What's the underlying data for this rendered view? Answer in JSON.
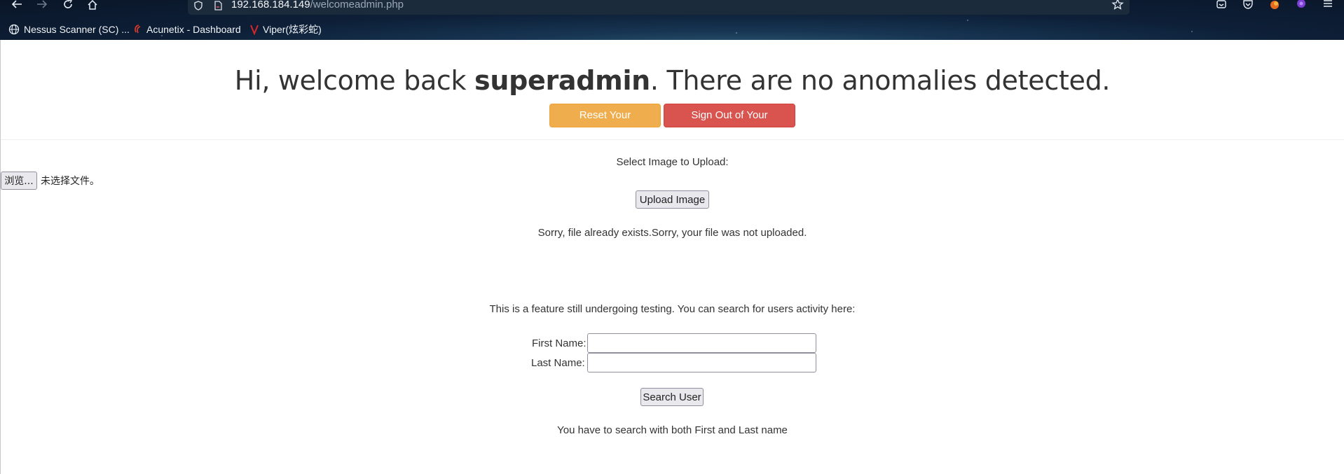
{
  "browser": {
    "url_host": "192.168.184.149",
    "url_path": "/welcomeadmin.php",
    "bookmarks": [
      {
        "label": "Nessus Scanner (SC) ...",
        "icon": "globe-icon"
      },
      {
        "label": "Acunetix - Dashboard",
        "icon": "acunetix-logo-icon"
      },
      {
        "label": "Viper(炫彩蛇)",
        "icon": "viper-logo-icon"
      }
    ]
  },
  "header": {
    "greeting_prefix": "Hi, welcome back",
    "username": "superadmin",
    "greeting_suffix": ". There are no anomalies detected."
  },
  "actions": {
    "reset_password_label": "Reset Your Password",
    "sign_out_label": "Sign Out of Your Account"
  },
  "upload": {
    "prompt": "Select Image to Upload:",
    "browse_label": "浏览...",
    "file_status": "未选择文件。",
    "upload_button_label": "Upload Image",
    "result_message": "Sorry, file already exists.Sorry, your file was not uploaded."
  },
  "search": {
    "intro": "This is a feature still undergoing testing. You can search for users activity here:",
    "first_name_label": "First Name:",
    "first_name_value": "",
    "last_name_label": "Last Name:",
    "last_name_value": "",
    "search_button_label": "Search User",
    "hint": "You have to search with both First and Last name"
  },
  "colors": {
    "warning": "#f0ad4e",
    "danger": "#d9534f",
    "text": "#333333"
  }
}
